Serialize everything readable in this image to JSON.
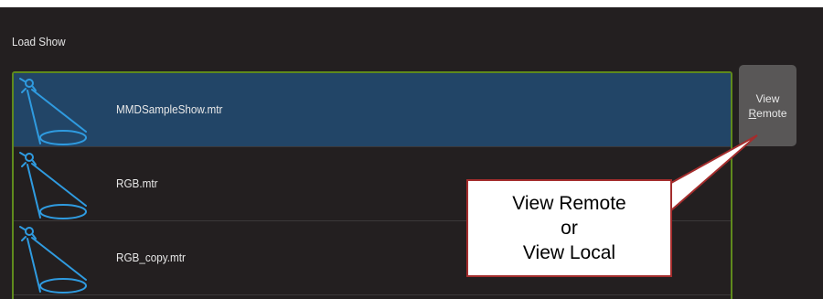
{
  "window": {
    "title": "Load Show"
  },
  "shows": [
    {
      "name": "MMDSampleShow.mtr",
      "selected": true
    },
    {
      "name": "RGB.mtr",
      "selected": false
    },
    {
      "name": "RGB_copy.mtr",
      "selected": false
    }
  ],
  "side_button": {
    "line1": "View",
    "line2_accel": "R",
    "line2_rest": "emote"
  },
  "callout": {
    "line1": "View Remote",
    "line2": "or",
    "line3": "View Local"
  },
  "colors": {
    "background": "#231f20",
    "selection": "#224567",
    "list_border": "#5f8a1c",
    "icon": "#2f9be0",
    "button": "#595757",
    "callout_border": "#a42d2d"
  }
}
